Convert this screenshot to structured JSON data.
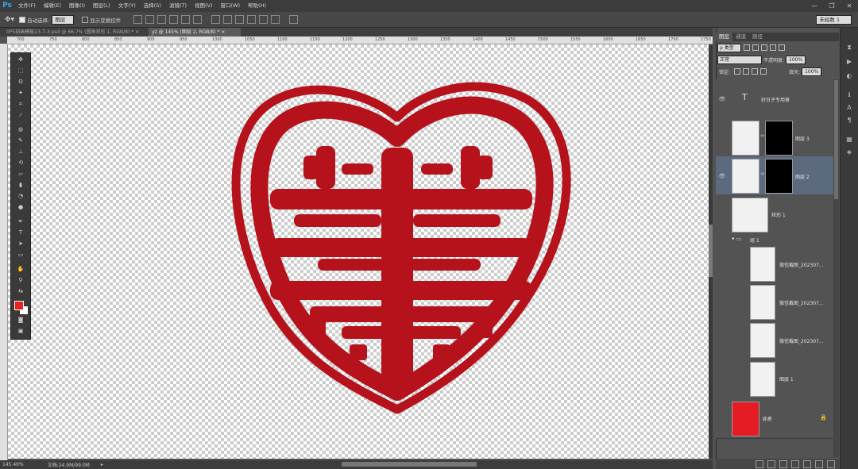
{
  "app": {
    "logo": "Ps"
  },
  "menu": [
    "文件(F)",
    "编辑(E)",
    "图像(I)",
    "图层(L)",
    "文字(Y)",
    "选择(S)",
    "滤镜(T)",
    "视图(V)",
    "窗口(W)",
    "帮助(H)"
  ],
  "window_controls": {
    "minimize": "—",
    "restore": "❐",
    "close": "✕"
  },
  "options": {
    "auto_select_label": "自动选择:",
    "auto_select_value": "图层",
    "show_transform_label": "显示变换控件",
    "workspace": "未经数 1"
  },
  "tabs": [
    {
      "label": "0P5刻画模板23-7-3.psd @ 66.7% (圆角矩形 1, RGB/8) *",
      "close": "×"
    },
    {
      "label": "yz @ 145% (图层 2, RGB/8) *",
      "close": "×"
    }
  ],
  "ruler_h": [
    "700",
    "750",
    "800",
    "850",
    "900",
    "950",
    "1000",
    "1050",
    "1100",
    "1150",
    "1200",
    "1250",
    "1300",
    "1350",
    "1400",
    "1450",
    "1500",
    "1550",
    "1600",
    "1650",
    "1700",
    "1750"
  ],
  "status": {
    "zoom": "145.46%",
    "doc": "文档:24.9M/99.0M"
  },
  "panel_tabs": [
    "图层",
    "通道",
    "路径"
  ],
  "layers_panel": {
    "filter_label": "ρ 类型",
    "blend_mode": "正常",
    "opacity_label": "不透明度:",
    "opacity": "100%",
    "lock_label": "锁定:",
    "fill_label": "填充:",
    "fill": "100%"
  },
  "layers": [
    {
      "name": "好日子专用章",
      "type": "text"
    },
    {
      "name": "图层 3",
      "type": "masked"
    },
    {
      "name": "图层 2",
      "type": "masked",
      "selected": true
    },
    {
      "name": "矩形 1",
      "type": "shape"
    },
    {
      "name": "组 1",
      "type": "group"
    },
    {
      "name": "微信截图_202307...",
      "type": "image"
    },
    {
      "name": "微信截图_202307...",
      "type": "image"
    },
    {
      "name": "微信截图_202307...",
      "type": "image"
    },
    {
      "name": "图层 1",
      "type": "plain"
    },
    {
      "name": "背景",
      "type": "background"
    }
  ],
  "colors": {
    "stamp_red": "#b5121b",
    "foreground": "#e52420",
    "background_layer": "#e51c23",
    "selection": "#5c6a80"
  }
}
